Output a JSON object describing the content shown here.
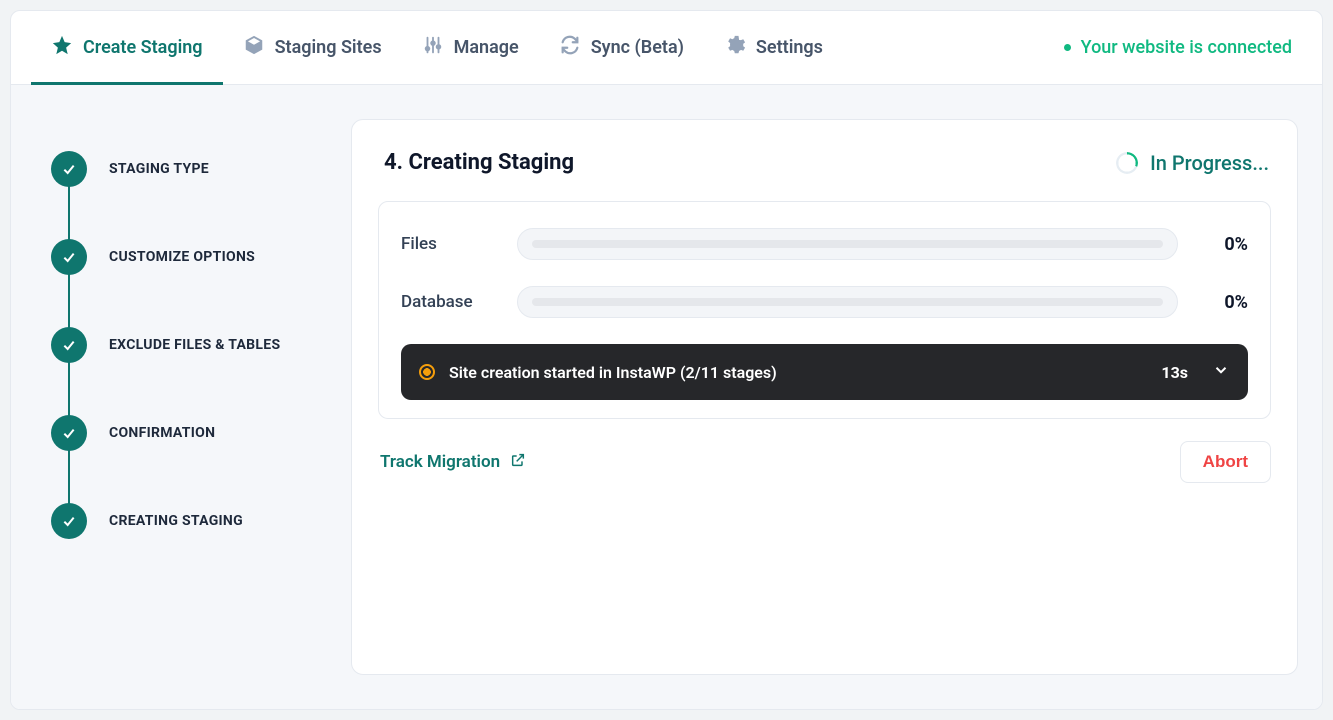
{
  "tabs": {
    "create": "Create Staging",
    "sites": "Staging Sites",
    "manage": "Manage",
    "sync": "Sync (Beta)",
    "settings": "Settings"
  },
  "connection_status": "Your website is connected",
  "steps": [
    {
      "label": "Staging Type"
    },
    {
      "label": "Customize Options"
    },
    {
      "label": "Exclude Files & Tables"
    },
    {
      "label": "Confirmation"
    },
    {
      "label": "Creating Staging"
    }
  ],
  "card": {
    "title": "4. Creating Staging",
    "status": "In Progress..."
  },
  "progress": {
    "files": {
      "label": "Files",
      "pct": "0%"
    },
    "database": {
      "label": "Database",
      "pct": "0%"
    }
  },
  "log": {
    "message": "Site creation started in InstaWP (2/11 stages)",
    "elapsed": "13s"
  },
  "track_link": "Track Migration",
  "abort": "Abort"
}
